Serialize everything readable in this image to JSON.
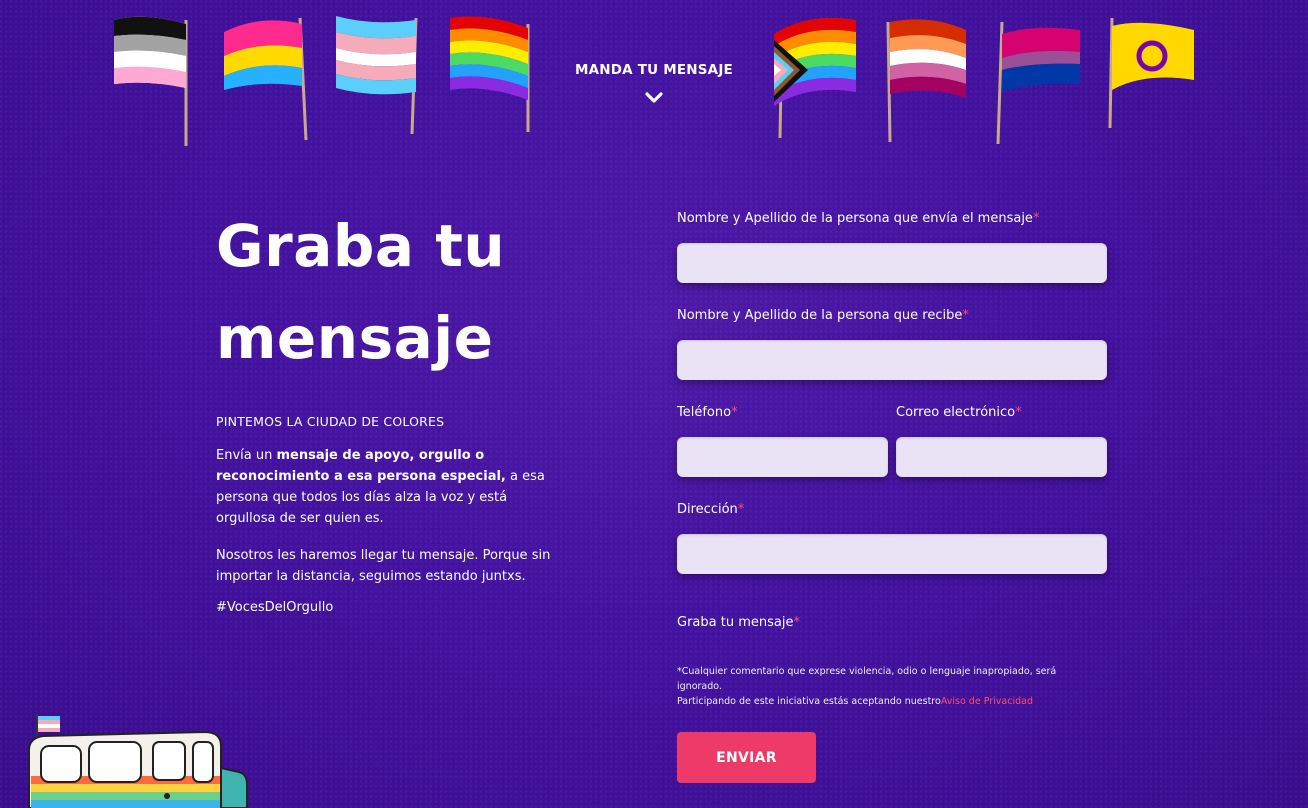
{
  "header": {
    "cta_label": "MANDA TU MENSAJE",
    "flags": [
      "asexual-flag",
      "pansexual-flag",
      "transgender-flag",
      "rainbow-flag",
      "progress-pride-flag",
      "lesbian-flag",
      "bisexual-flag",
      "intersex-flag"
    ]
  },
  "intro": {
    "title_line1": "Graba tu",
    "title_line2": "mensaje",
    "kicker": "PINTEMOS LA CIUDAD DE COLORES",
    "p1_start": "Envía un ",
    "p1_bold": "mensaje de apoyo, orgullo o reconocimiento a esa persona especial,",
    "p1_end": " a esa persona que todos los días alza la voz y está orgullosa de ser quien es.",
    "p2": "Nosotros les haremos llegar tu mensaje. Porque sin importar la distancia, seguimos estando juntxs.",
    "hashtag": "#VocesDelOrgullo"
  },
  "form": {
    "sender_label": "Nombre y Apellido de la persona que envía el mensaje",
    "receiver_label": "Nombre y Apellido de la persona que recibe",
    "phone_label": "Teléfono",
    "email_label": "Correo electrónico",
    "address_label": "Dirección",
    "record_label": "Graba tu mensaje",
    "required_mark": "*",
    "disclaimer_line1": "*Cualquier comentario que exprese violencia, odio o lenguaje inapropiado, será ignorado.",
    "disclaimer_line2": "Participando de este iniciativa estás aceptando nuestro",
    "privacy_link": "Aviso de Privacidad",
    "submit_label": "ENVIAR"
  },
  "colors": {
    "background": "#4412a0",
    "accent": "#ee3a68",
    "input_bg": "#eae3f6"
  }
}
